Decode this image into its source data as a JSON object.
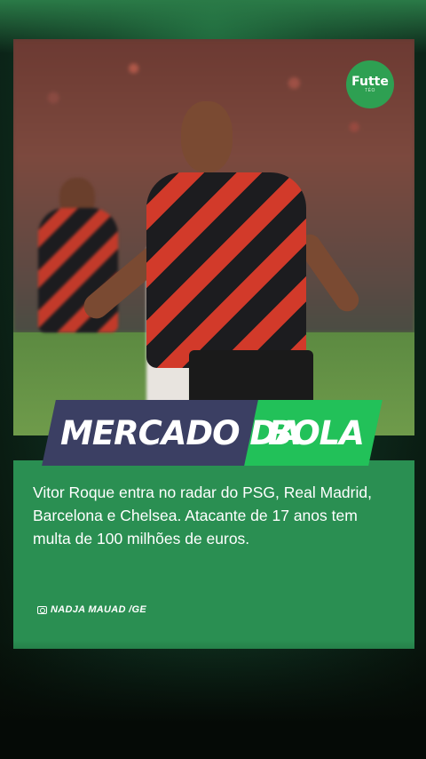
{
  "photo": {
    "description_icon": "player-photo"
  },
  "logo": {
    "text": "Futte",
    "sub": "TÉO"
  },
  "banner": {
    "left_text": "MERCADO DA",
    "right_text": "BOLA",
    "left_color": "#3b3f63",
    "right_color": "#22c159"
  },
  "card": {
    "body": "Vitor Roque entra no radar do PSG, Real Madrid, Barcelona e Chelsea. Atacante de 17 anos tem multa de 100 milhões de euros.",
    "credit": "NADJA MAUAD /GE",
    "color": "#2a8f52"
  }
}
